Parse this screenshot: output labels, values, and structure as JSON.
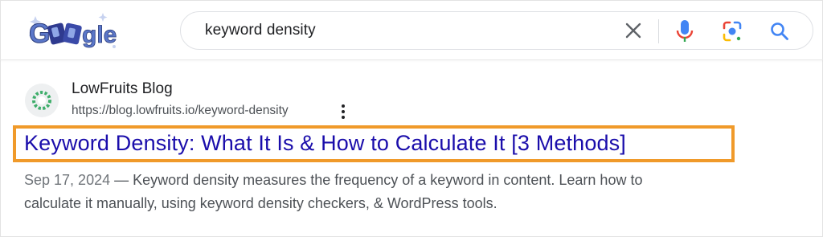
{
  "header": {
    "logo_text": "Google",
    "search": {
      "value": "keyword density",
      "clear_icon": "close-icon",
      "voice_icon": "mic-icon",
      "lens_icon": "google-lens-icon",
      "search_icon": "search-icon"
    }
  },
  "result": {
    "site_name": "LowFruits Blog",
    "url": "https://blog.lowfruits.io/keyword-density",
    "more_icon": "more-vert-icon",
    "title": "Keyword Density: What It Is & How to Calculate It [3 Methods]",
    "date": "Sep 17, 2024",
    "snippet_line1": " — Keyword density measures the frequency of a keyword in content. Learn how to",
    "snippet_line2": "calculate it manually, using keyword density checkers, & WordPress tools."
  },
  "colors": {
    "link": "#1a0dab",
    "highlight": "#f09a2a",
    "text": "#202124",
    "muted": "#4d5156"
  }
}
